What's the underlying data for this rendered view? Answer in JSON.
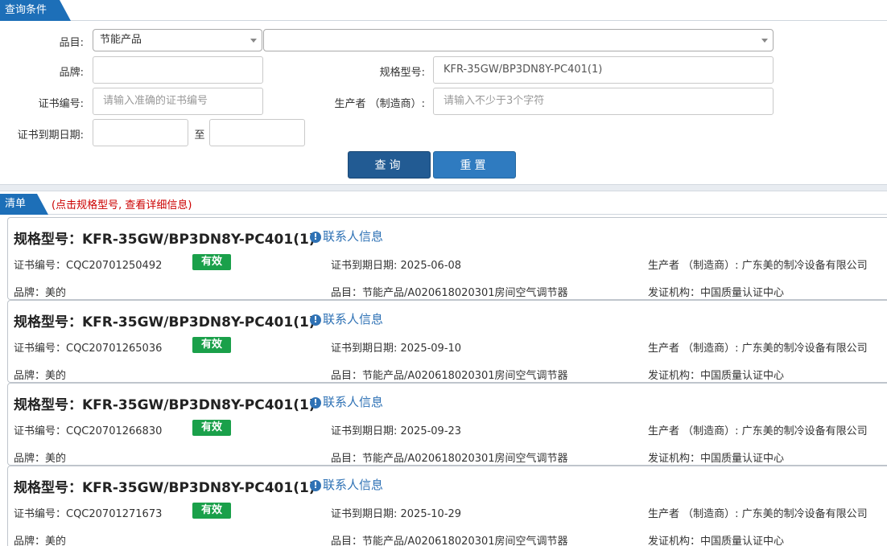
{
  "query": {
    "title": "查询条件",
    "category_label": "品目:",
    "category_value": "节能产品",
    "subcategory_value": "",
    "brand_label": "品牌:",
    "brand_value": "",
    "model_label": "规格型号:",
    "model_value": "KFR-35GW/BP3DN8Y-PC401(1)",
    "cert_label": "证书编号:",
    "cert_placeholder": "请输入准确的证书编号",
    "maker_label": "生产者 （制造商）:",
    "maker_placeholder": "请输入不少于3个字符",
    "expiry_label": "证书到期日期:",
    "expiry_from": "",
    "expiry_to_label": "至",
    "expiry_to": "",
    "search_button": "查询",
    "reset_button": "重置"
  },
  "list": {
    "title": "清单",
    "hint": "(点击规格型号, 查看详细信息)",
    "contact_label": "联系人信息",
    "items": [
      {
        "title": "规格型号：KFR-35GW/BP3DN8Y-PC401(1)",
        "cert": "证书编号：CQC20701250492",
        "status": "有效",
        "expiry": "证书到期日期: 2025-06-08",
        "maker": "生产者 （制造商）: 广东美的制冷设备有限公司",
        "brand": "品牌：美的",
        "category": "品目：节能产品/A020618020301房间空气调节器",
        "issuer": "发证机构：中国质量认证中心"
      },
      {
        "title": "规格型号：KFR-35GW/BP3DN8Y-PC401(1)",
        "cert": "证书编号：CQC20701265036",
        "status": "有效",
        "expiry": "证书到期日期: 2025-09-10",
        "maker": "生产者 （制造商）: 广东美的制冷设备有限公司",
        "brand": "品牌：美的",
        "category": "品目：节能产品/A020618020301房间空气调节器",
        "issuer": "发证机构：中国质量认证中心"
      },
      {
        "title": "规格型号：KFR-35GW/BP3DN8Y-PC401(1)",
        "cert": "证书编号：CQC20701266830",
        "status": "有效",
        "expiry": "证书到期日期: 2025-09-23",
        "maker": "生产者 （制造商）: 广东美的制冷设备有限公司",
        "brand": "品牌：美的",
        "category": "品目：节能产品/A020618020301房间空气调节器",
        "issuer": "发证机构：中国质量认证中心"
      },
      {
        "title": "规格型号：KFR-35GW/BP3DN8Y-PC401(1)",
        "cert": "证书编号：CQC20701271673",
        "status": "有效",
        "expiry": "证书到期日期: 2025-10-29",
        "maker": "生产者 （制造商）: 广东美的制冷设备有限公司",
        "brand": "品牌：美的",
        "category": "品目：节能产品/A020618020301房间空气调节器",
        "issuer": "发证机构：中国质量认证中心"
      }
    ]
  },
  "colors": {
    "accent": "#1d6fb8",
    "valid_badge": "#1aa04a",
    "hint_text": "#cc0000",
    "link": "#2f72b5"
  },
  "icons": {
    "contact": "info-circle-icon",
    "dropdown": "caret-down-icon"
  }
}
